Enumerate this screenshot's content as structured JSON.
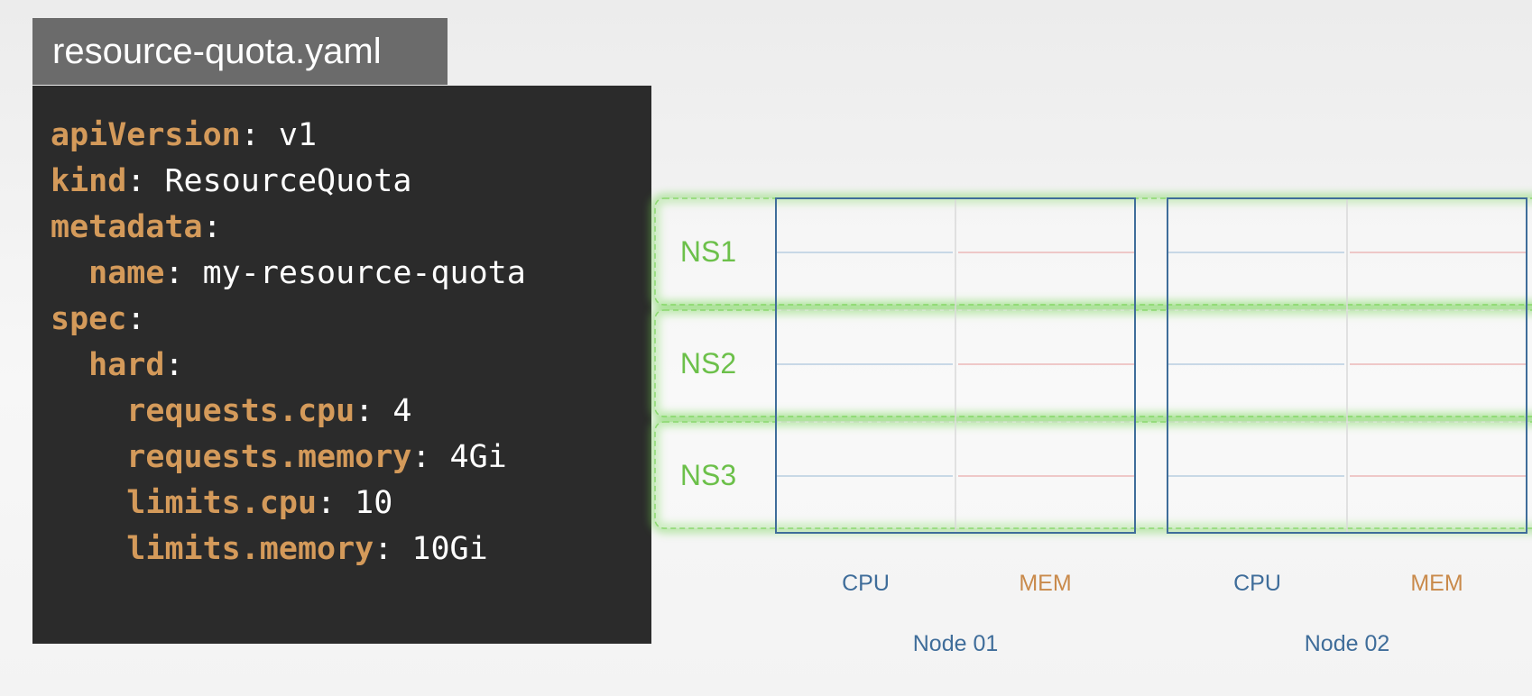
{
  "file": {
    "title": "resource-quota.yaml"
  },
  "code_lines": [
    {
      "indent": "",
      "key": "apiVersion",
      "sep": ": ",
      "value": "v1"
    },
    {
      "indent": "",
      "key": "kind",
      "sep": ": ",
      "value": "ResourceQuota"
    },
    {
      "indent": "",
      "key": "metadata",
      "sep": ":",
      "value": ""
    },
    {
      "indent": "  ",
      "key": "name",
      "sep": ": ",
      "value": "my-resource-quota"
    },
    {
      "indent": "",
      "key": "spec",
      "sep": ":",
      "value": ""
    },
    {
      "indent": "  ",
      "key": "hard",
      "sep": ":",
      "value": ""
    },
    {
      "indent": "    ",
      "key": "requests.cpu",
      "sep": ": ",
      "value": "4"
    },
    {
      "indent": "    ",
      "key": "requests.memory",
      "sep": ": ",
      "value": "4Gi"
    },
    {
      "indent": "    ",
      "key": "limits.cpu",
      "sep": ": ",
      "value": "10"
    },
    {
      "indent": "    ",
      "key": "limits.memory",
      "sep": ": ",
      "value": "10Gi"
    }
  ],
  "diagram": {
    "namespaces": [
      "NS1",
      "NS2",
      "NS3"
    ],
    "nodes": [
      {
        "name": "Node 01",
        "cpu_label": "CPU",
        "mem_label": "MEM"
      },
      {
        "name": "Node 02",
        "cpu_label": "CPU",
        "mem_label": "MEM"
      }
    ],
    "colors": {
      "node_border": "#3f6d9a",
      "ns_highlight": "#6cd24a",
      "ns_text": "#6cc04a",
      "cpu_text": "#3f6d9a",
      "mem_text": "#c98a4b",
      "cpu_line": "#b8cde0",
      "mem_line": "#ecb8b8",
      "code_key": "#d49a5a",
      "code_bg": "#2b2b2b",
      "tab_bg": "#6b6b6b"
    }
  }
}
